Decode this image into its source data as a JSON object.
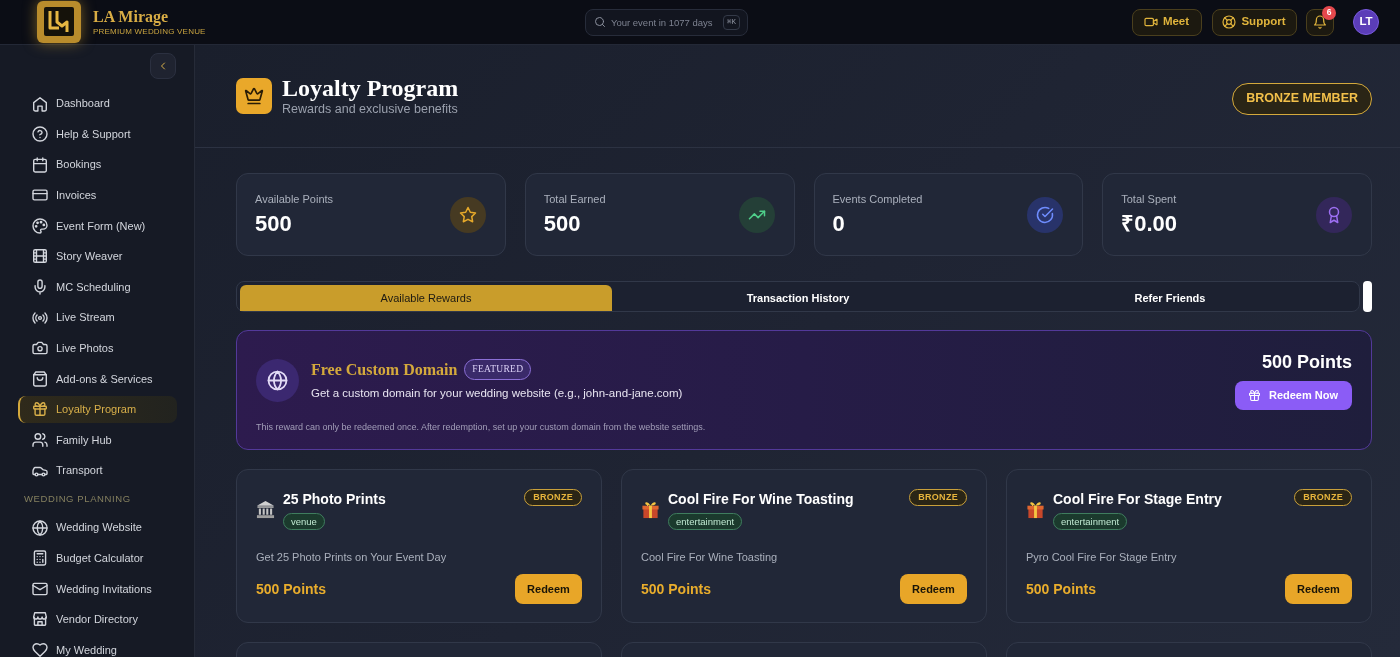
{
  "header": {
    "brand": "LA Mirage",
    "tagline": "PREMIUM WEDDING VENUE",
    "search": {
      "placeholder": "Your event in 1077 days",
      "shortcut": "⌘K"
    },
    "actions": [
      {
        "label": "Meet"
      },
      {
        "label": "Support"
      }
    ],
    "notifications": {
      "count": "6"
    },
    "avatar": {
      "initials": "LT"
    }
  },
  "sidebar": {
    "items": [
      {
        "label": "Dashboard",
        "selected": false
      },
      {
        "label": "Help & Support",
        "selected": false
      },
      {
        "label": "Bookings",
        "selected": false
      },
      {
        "label": "Invoices",
        "selected": false
      },
      {
        "label": "Event Form (New)",
        "selected": false
      },
      {
        "label": "Story Weaver",
        "selected": false
      },
      {
        "label": "MC Scheduling",
        "selected": false
      },
      {
        "label": "Live Stream",
        "selected": false
      },
      {
        "label": "Live Photos",
        "selected": false
      },
      {
        "label": "Add-ons & Services",
        "selected": false
      },
      {
        "label": "Loyalty Program",
        "selected": true
      },
      {
        "label": "Family Hub",
        "selected": false
      },
      {
        "label": "Transport",
        "selected": false
      }
    ],
    "sections": [
      {
        "heading": "WEDDING PLANNING",
        "items": [
          {
            "label": "Wedding Website",
            "selected": false
          },
          {
            "label": "Budget Calculator",
            "selected": false
          },
          {
            "label": "Wedding Invitations",
            "selected": false
          },
          {
            "label": "Vendor Directory",
            "selected": false
          },
          {
            "label": "My Wedding",
            "selected": false
          }
        ]
      }
    ]
  },
  "page": {
    "title": "Loyalty Program",
    "subtitle": "Rewards and exclusive benefits",
    "membership": "BRONZE MEMBER"
  },
  "stats": [
    {
      "label": "Available Points",
      "value": "500"
    },
    {
      "label": "Total Earned",
      "value": "500"
    },
    {
      "label": "Events Completed",
      "value": "0"
    },
    {
      "label": "Total Spent",
      "value": "₹0.00"
    }
  ],
  "tabs": [
    {
      "label": "Available Rewards",
      "selected": true
    },
    {
      "label": "Transaction History",
      "selected": false
    },
    {
      "label": "Refer Friends",
      "selected": false
    }
  ],
  "featured_reward": {
    "title": "Free Custom Domain",
    "badge": "FEATURED",
    "description": "Get a custom domain for your wedding website (e.g., john-and-jane.com)",
    "note": "This reward can only be redeemed once. After redemption, set up your custom domain from the website settings.",
    "points": "500 Points",
    "button": "Redeem Now"
  },
  "rewards": [
    {
      "title": "25 Photo Prints",
      "category": "venue",
      "tier": "BRONZE",
      "description": "Get 25 Photo Prints on Your Event Day",
      "points": "500 Points",
      "button": "Redeem"
    },
    {
      "title": "Cool Fire For Wine Toasting",
      "category": "entertainment",
      "tier": "BRONZE",
      "description": "Cool Fire For Wine Toasting",
      "points": "500 Points",
      "button": "Redeem"
    },
    {
      "title": "Cool Fire For Stage Entry",
      "category": "entertainment",
      "tier": "BRONZE",
      "description": "Pyro Cool Fire For Stage Entry",
      "points": "500 Points",
      "button": "Redeem"
    }
  ]
}
